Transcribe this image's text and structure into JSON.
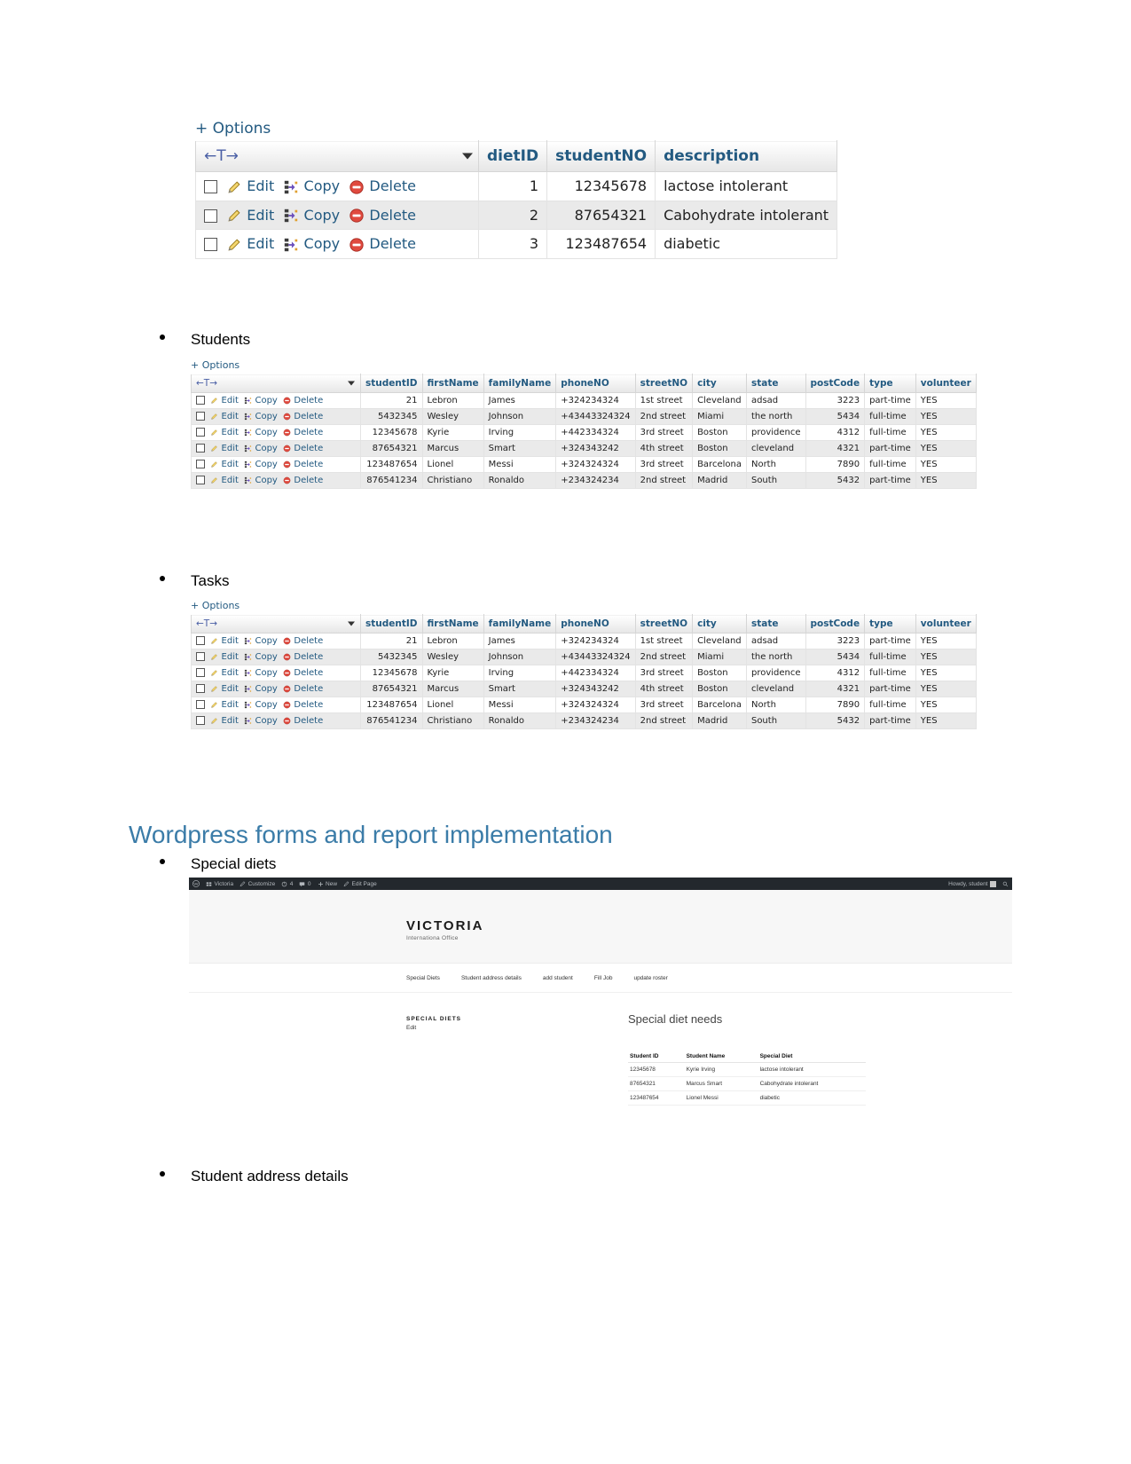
{
  "diet_table": {
    "options_label": "+ Options",
    "sort_label": "←T→",
    "row_actions": {
      "edit": "Edit",
      "copy": "Copy",
      "delete": "Delete"
    },
    "columns": [
      "dietID",
      "studentNO",
      "description"
    ],
    "rows": [
      {
        "dietID": "1",
        "studentNO": "12345678",
        "description": "lactose intolerant"
      },
      {
        "dietID": "2",
        "studentNO": "87654321",
        "description": "Cabohydrate intolerant"
      },
      {
        "dietID": "3",
        "studentNO": "123487654",
        "description": "diabetic"
      }
    ]
  },
  "students_heading": "Students",
  "tasks_heading": "Tasks",
  "students_table": {
    "options_label": "+ Options",
    "sort_label": "←T→",
    "row_actions": {
      "edit": "Edit",
      "copy": "Copy",
      "delete": "Delete"
    },
    "columns": [
      "studentID",
      "firstName",
      "familyName",
      "phoneNO",
      "streetNO",
      "city",
      "state",
      "postCode",
      "type",
      "volunteer"
    ],
    "rows": [
      {
        "studentID": "21",
        "firstName": "Lebron",
        "familyName": "James",
        "phoneNO": "+324234324",
        "streetNO": "1st street",
        "city": "Cleveland",
        "state": "adsad",
        "postCode": "3223",
        "type": "part-time",
        "volunteer": "YES"
      },
      {
        "studentID": "5432345",
        "firstName": "Wesley",
        "familyName": "Johnson",
        "phoneNO": "+43443324324",
        "streetNO": "2nd street",
        "city": "Miami",
        "state": "the north",
        "postCode": "5434",
        "type": "full-time",
        "volunteer": "YES"
      },
      {
        "studentID": "12345678",
        "firstName": "Kyrie",
        "familyName": "Irving",
        "phoneNO": "+442334324",
        "streetNO": "3rd street",
        "city": "Boston",
        "state": "providence",
        "postCode": "4312",
        "type": "full-time",
        "volunteer": "YES"
      },
      {
        "studentID": "87654321",
        "firstName": "Marcus",
        "familyName": "Smart",
        "phoneNO": "+324343242",
        "streetNO": "4th street",
        "city": "Boston",
        "state": "cleveland",
        "postCode": "4321",
        "type": "part-time",
        "volunteer": "YES"
      },
      {
        "studentID": "123487654",
        "firstName": "Lionel",
        "familyName": "Messi",
        "phoneNO": "+324324324",
        "streetNO": "3rd street",
        "city": "Barcelona",
        "state": "North",
        "postCode": "7890",
        "type": "full-time",
        "volunteer": "YES"
      },
      {
        "studentID": "876541234",
        "firstName": "Christiano",
        "familyName": "Ronaldo",
        "phoneNO": "+234324234",
        "streetNO": "2nd street",
        "city": "Madrid",
        "state": "South",
        "postCode": "5432",
        "type": "part-time",
        "volunteer": "YES"
      }
    ]
  },
  "tasks_table": {
    "options_label": "+ Options",
    "sort_label": "←T→",
    "row_actions": {
      "edit": "Edit",
      "copy": "Copy",
      "delete": "Delete"
    },
    "columns": [
      "studentID",
      "firstName",
      "familyName",
      "phoneNO",
      "streetNO",
      "city",
      "state",
      "postCode",
      "type",
      "volunteer"
    ],
    "rows": [
      {
        "studentID": "21",
        "firstName": "Lebron",
        "familyName": "James",
        "phoneNO": "+324234324",
        "streetNO": "1st street",
        "city": "Cleveland",
        "state": "adsad",
        "postCode": "3223",
        "type": "part-time",
        "volunteer": "YES"
      },
      {
        "studentID": "5432345",
        "firstName": "Wesley",
        "familyName": "Johnson",
        "phoneNO": "+43443324324",
        "streetNO": "2nd street",
        "city": "Miami",
        "state": "the north",
        "postCode": "5434",
        "type": "full-time",
        "volunteer": "YES"
      },
      {
        "studentID": "12345678",
        "firstName": "Kyrie",
        "familyName": "Irving",
        "phoneNO": "+442334324",
        "streetNO": "3rd street",
        "city": "Boston",
        "state": "providence",
        "postCode": "4312",
        "type": "full-time",
        "volunteer": "YES"
      },
      {
        "studentID": "87654321",
        "firstName": "Marcus",
        "familyName": "Smart",
        "phoneNO": "+324343242",
        "streetNO": "4th street",
        "city": "Boston",
        "state": "cleveland",
        "postCode": "4321",
        "type": "part-time",
        "volunteer": "YES"
      },
      {
        "studentID": "123487654",
        "firstName": "Lionel",
        "familyName": "Messi",
        "phoneNO": "+324324324",
        "streetNO": "3rd street",
        "city": "Barcelona",
        "state": "North",
        "postCode": "7890",
        "type": "full-time",
        "volunteer": "YES"
      },
      {
        "studentID": "876541234",
        "firstName": "Christiano",
        "familyName": "Ronaldo",
        "phoneNO": "+234324234",
        "streetNO": "2nd street",
        "city": "Madrid",
        "state": "South",
        "postCode": "5432",
        "type": "part-time",
        "volunteer": "YES"
      }
    ]
  },
  "section_heading": "Wordpress forms and report implementation",
  "special_diets_bullet": "Special diets",
  "student_address_bullet": "Student address details",
  "wordpress": {
    "adminbar": {
      "site_name": "Victoria",
      "customize": "Customize",
      "updates_count": "4",
      "comments_count": "0",
      "new": "New",
      "edit_page": "Edit Page",
      "howdy": "Howdy, student"
    },
    "brand_title": "VICTORIA",
    "brand_subtitle": "Internationa Office",
    "nav": [
      "Special Diets",
      "Student address details",
      "add student",
      "Fill Job",
      "update roster"
    ],
    "sidebar_title": "SPECIAL DIETS",
    "sidebar_edit": "Edit",
    "main_title": "Special diet needs",
    "table": {
      "columns": [
        "Student ID",
        "Student Name",
        "Special Diet"
      ],
      "rows": [
        {
          "id": "12345678",
          "name": "Kyrie Irving",
          "diet": "lactose intolerant"
        },
        {
          "id": "87654321",
          "name": "Marcus Smart",
          "diet": "Cabohydrate intolerant"
        },
        {
          "id": "123487654",
          "name": "Lionel Messi",
          "diet": "diabetic"
        }
      ]
    }
  },
  "colors": {
    "link": "#235a81",
    "heading": "#3b7ca8",
    "adminbar_bg": "#23282d"
  }
}
